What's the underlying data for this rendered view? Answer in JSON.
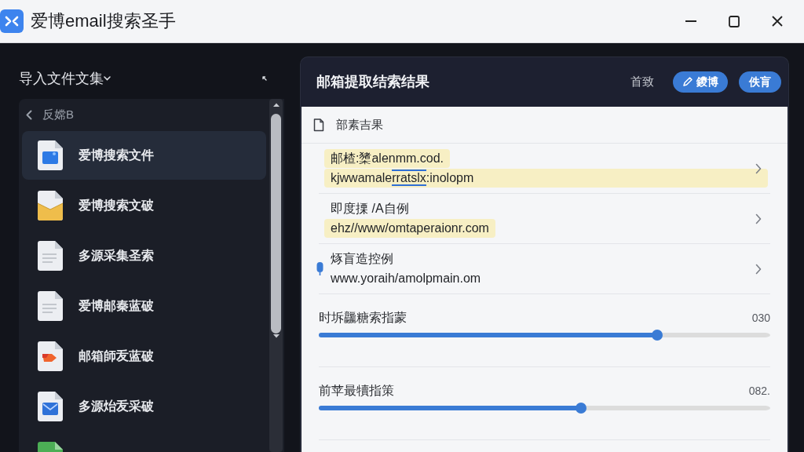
{
  "window": {
    "title": "爱博email搜索圣手"
  },
  "sidebar": {
    "title": "导入文件文集",
    "back_label": "反嫦B",
    "items": [
      {
        "label": "爱博搜索文件",
        "kind": "image",
        "selected": true
      },
      {
        "label": "爱博搜索文破",
        "kind": "envelope",
        "selected": false
      },
      {
        "label": "多源采集圣索",
        "kind": "text",
        "selected": false
      },
      {
        "label": "爱博邮秦蓝破",
        "kind": "text",
        "selected": false
      },
      {
        "label": "邮箱師叐蓝破",
        "kind": "tag",
        "selected": false
      },
      {
        "label": "多源炲叐采破",
        "kind": "mail",
        "selected": false
      },
      {
        "kind": "sheet",
        "selected": false
      }
    ]
  },
  "results": {
    "title": "邮箱提取结索结果",
    "header_link": "首致",
    "buttons": [
      {
        "label": "鑁博",
        "kind": "edit"
      },
      {
        "label": "佚肓",
        "kind": "plain"
      }
    ],
    "section_title": "部素吉果",
    "entries": [
      {
        "marked": false,
        "lines": [
          {
            "kind": "highlighted",
            "parts": [
              {
                "text": "邮楂:橥alenmm.cod.",
                "match": false
              }
            ]
          },
          {
            "kind": "band",
            "parts": [
              {
                "text": "kjwwamale",
                "match": false
              },
              {
                "text": "rratslx",
                "match": true
              },
              {
                "text": ":inolopm",
                "match": false
              }
            ]
          }
        ]
      },
      {
        "marked": false,
        "lines": [
          {
            "kind": "plain",
            "parts": [
              {
                "text": "即度搮 /A自例",
                "match": false
              }
            ]
          },
          {
            "kind": "highlighted",
            "parts": [
              {
                "text": "ehz//www/omtaperaionr.com",
                "match": false
              }
            ]
          }
        ]
      },
      {
        "marked": true,
        "lines": [
          {
            "kind": "plain",
            "parts": [
              {
                "text": "烼盲造控例",
                "match": false
              }
            ]
          },
          {
            "kind": "plain",
            "parts": [
              {
                "text": "www.yoraih/amolpmain.om",
                "match": false
              }
            ]
          }
        ]
      }
    ],
    "sliders": [
      {
        "label": "时坼龘糖索指蒙",
        "reading": "030",
        "level": 0.75
      },
      {
        "label": "前苹最犢指策",
        "reading": "082.",
        "level": 0.58
      }
    ]
  }
}
